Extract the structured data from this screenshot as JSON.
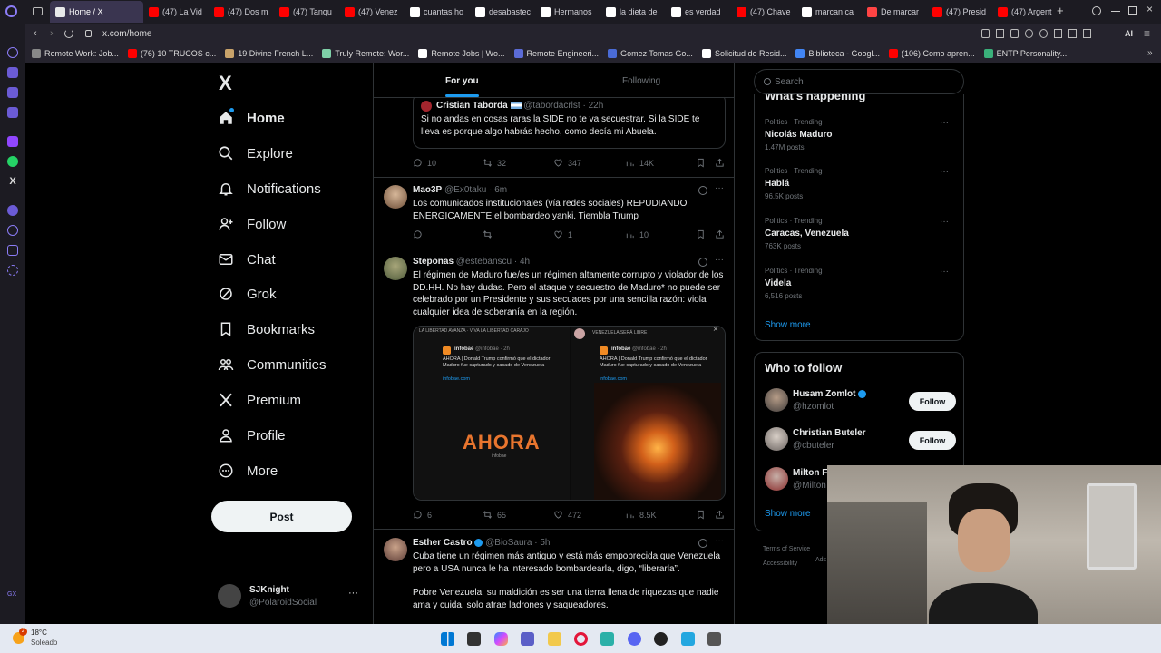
{
  "browser": {
    "tabs": [
      {
        "label": "Home / X",
        "color": "#3a3550",
        "active": true
      },
      {
        "label": "(47) La Vid",
        "color": "#ff0000"
      },
      {
        "label": "(47) Dos m",
        "color": "#ff0000"
      },
      {
        "label": "(47) Tanqu",
        "color": "#ff0000"
      },
      {
        "label": "(47) Venez",
        "color": "#ff0000"
      },
      {
        "label": "cuantas ho",
        "color": "#ffffff"
      },
      {
        "label": "desabastec",
        "color": "#ffffff"
      },
      {
        "label": "Hermanos",
        "color": "#ffffff"
      },
      {
        "label": "la dieta de",
        "color": "#ffffff"
      },
      {
        "label": "es verdad",
        "color": "#ffffff"
      },
      {
        "label": "(47) Chave",
        "color": "#ff0000"
      },
      {
        "label": "marcan ca",
        "color": "#ffffff"
      },
      {
        "label": "De marcar",
        "color": "#ff4444"
      },
      {
        "label": "(47) Presid",
        "color": "#ff0000"
      },
      {
        "label": "(47) Argent",
        "color": "#ff0000"
      }
    ],
    "address": "x.com/home",
    "ai_label": "AI",
    "bookmarks": [
      {
        "label": "Remote Work: Job...",
        "color": "#888"
      },
      {
        "label": "(76) 10 TRUCOS c...",
        "color": "#ff0000"
      },
      {
        "label": "19 Divine French L...",
        "color": "#c9a36a"
      },
      {
        "label": "Truly Remote: Wor...",
        "color": "#7fd1a8"
      },
      {
        "label": "Remote Jobs | Wo...",
        "color": "#ffffff"
      },
      {
        "label": "Remote Engineeri...",
        "color": "#5b6bd6"
      },
      {
        "label": "Gomez Tomas Go...",
        "color": "#4a6bd6"
      },
      {
        "label": "Solicitud de Resid...",
        "color": "#ffffff"
      },
      {
        "label": "Biblioteca - Googl...",
        "color": "#4285f4"
      },
      {
        "label": "(106) Como apren...",
        "color": "#ff0000"
      },
      {
        "label": "ENTP Personality...",
        "color": "#3ab07a"
      }
    ]
  },
  "nav": {
    "items": [
      {
        "label": "Home",
        "icon": "home-icon"
      },
      {
        "label": "Explore",
        "icon": "search-icon"
      },
      {
        "label": "Notifications",
        "icon": "bell-icon"
      },
      {
        "label": "Follow",
        "icon": "person-add-icon"
      },
      {
        "label": "Chat",
        "icon": "mail-icon"
      },
      {
        "label": "Grok",
        "icon": "grok-icon"
      },
      {
        "label": "Bookmarks",
        "icon": "bookmark-icon"
      },
      {
        "label": "Communities",
        "icon": "people-icon"
      },
      {
        "label": "Premium",
        "icon": "x-logo-icon"
      },
      {
        "label": "Profile",
        "icon": "profile-icon"
      },
      {
        "label": "More",
        "icon": "more-icon"
      }
    ],
    "post_label": "Post",
    "account": {
      "name": "SJKnight",
      "handle": "@PolaroidSocial"
    }
  },
  "feed": {
    "tabs": {
      "for_you": "For you",
      "following": "Following"
    },
    "tweets": [
      {
        "name": "Cristian Taborda",
        "handle": "@tabordacrlst",
        "time": "· 22h",
        "text": "Si no andas en cosas raras la SIDE no te va secuestrar. Si la SIDE te lleva es porque algo habrás hecho, como decía mi Abuela.",
        "replies": "10",
        "reposts": "32",
        "likes": "347",
        "views": "14K"
      },
      {
        "name": "Mao3P",
        "handle": "@Ex0taku",
        "time": "· 6m",
        "text": "Los comunicados institucionales (vía redes sociales) REPUDIANDO ENERGICAMENTE el bombardeo yanki. Tiembla Trump",
        "replies": "",
        "reposts": "",
        "likes": "1",
        "views": "10"
      },
      {
        "name": "Steponas",
        "handle": "@estebanscu",
        "time": "· 4h",
        "text": "El régimen de Maduro fue/es un régimen altamente corrupto y violador de los DD.HH. No hay dudas. Pero el ataque y secuestro de Maduro* no puede ser celebrado por un Presidente y sus secuaces por una sencilla razón: viola cualquier idea de soberanía en la región.",
        "media": {
          "left_header": "LA LIBERTAD AVANZA · VIVA LA LIBERTAD CARAJO",
          "right_header": "VENEZUELA SERÁ LIBRE",
          "source": "infobae",
          "source_handle": "@infobae · 2h",
          "headline": "AHORA | Donald Trump confirmó que el dictador Maduro fue capturado y sacado de Venezuela",
          "link": "infobae.com",
          "big_text": "AHORA",
          "big_sub": "infobae"
        },
        "replies": "6",
        "reposts": "65",
        "likes": "472",
        "views": "8.5K"
      },
      {
        "name": "Esther Castro",
        "handle": "@BioSaura",
        "time": "· 5h",
        "text": "Cuba tiene un régimen más antiguo y está más empobrecida que Venezuela pero a USA nunca le ha interesado bombardearla, digo, “liberarla”.",
        "text2": "Pobre Venezuela, su maldición es ser una tierra llena de riquezas que nadie ama y cuida, solo atrae ladrones y saqueadores."
      }
    ]
  },
  "right": {
    "search_placeholder": "Search",
    "happening_title": "What's happening",
    "trends": [
      {
        "context": "Politics · Trending",
        "title": "Nicolás Maduro",
        "posts": "1.47M posts"
      },
      {
        "context": "Politics · Trending",
        "title": "Hablá",
        "posts": "96.5K posts"
      },
      {
        "context": "Politics · Trending",
        "title": "Caracas, Venezuela",
        "posts": "763K posts"
      },
      {
        "context": "Politics · Trending",
        "title": "Videla",
        "posts": "6,516 posts"
      }
    ],
    "show_more": "Show more",
    "wtf_title": "Who to follow",
    "follow_label": "Follow",
    "wtf": [
      {
        "name": "Husam Zomlot",
        "handle": "@hzomlot",
        "verified": true
      },
      {
        "name": "Christian Buteler",
        "handle": "@cbuteler"
      },
      {
        "name": "Milton F",
        "handle": "@Milton"
      }
    ],
    "footer": {
      "terms": "Terms of Service",
      "access": "Accessibility",
      "ads": "Ads"
    }
  },
  "taskbar": {
    "weather_temp": "18°C",
    "weather_desc": "Soleado",
    "weather_badge": "2"
  }
}
